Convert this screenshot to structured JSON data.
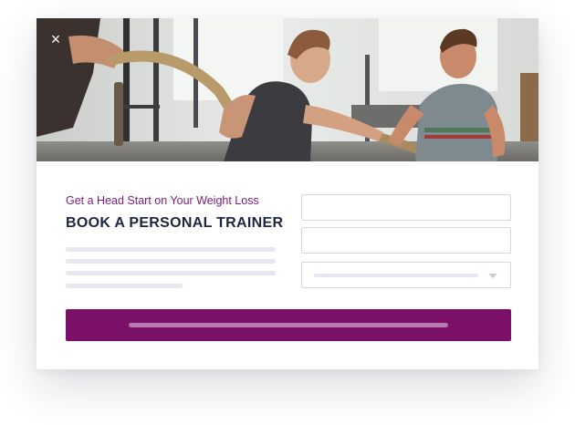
{
  "modal": {
    "close_label": "×",
    "subtitle": "Get a Head Start on Your Weight Loss",
    "title": "BOOK A PERSONAL TRAINER",
    "hero_image": "gym-training-photo"
  },
  "form": {
    "fields": [
      "text-field",
      "text-field",
      "dropdown-select"
    ],
    "submit_icon": "submit-button"
  },
  "colors": {
    "accent": "#7b1068",
    "subtitle": "#7b1a7a",
    "title": "#1f2540",
    "placeholder_lines": "#e7e7f1",
    "field_border": "#d6d6de"
  }
}
